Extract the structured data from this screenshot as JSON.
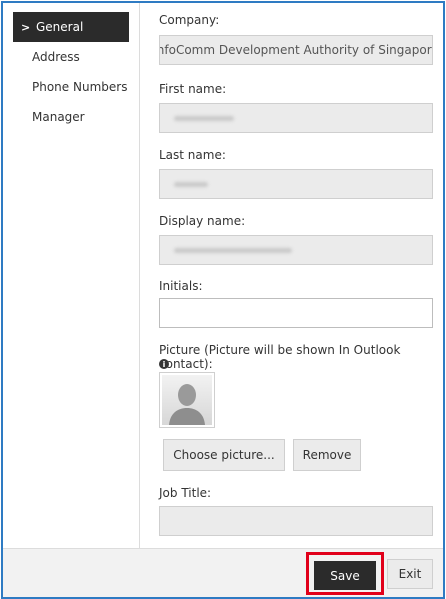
{
  "sidebar": {
    "items": [
      {
        "label": "General",
        "active": true
      },
      {
        "label": "Address",
        "active": false
      },
      {
        "label": "Phone Numbers",
        "active": false
      },
      {
        "label": "Manager",
        "active": false
      }
    ]
  },
  "form": {
    "company_label": "Company:",
    "company_value": "InfoComm Development Authority of Singapore",
    "first_name_label": "First name:",
    "first_name_value": "",
    "last_name_label": "Last name:",
    "last_name_value": "",
    "display_name_label": "Display name:",
    "display_name_value": "",
    "initials_label": "Initials:",
    "initials_value": "",
    "picture_label": "Picture (Picture will be shown In Outlook contact):",
    "choose_picture_label": "Choose picture...",
    "remove_label": "Remove",
    "job_title_label": "Job Title:",
    "job_title_value": ""
  },
  "footer": {
    "save_label": "Save",
    "exit_label": "Exit"
  },
  "icons": {
    "active_nav": "chevron-right-icon",
    "picture_info": "info-icon",
    "avatar": "user-silhouette-icon"
  },
  "colors": {
    "frame_border": "#2e7bc3",
    "active_nav_bg": "#2b2b2b",
    "save_highlight": "#e1001a",
    "readonly_field_bg": "#ebebeb"
  }
}
